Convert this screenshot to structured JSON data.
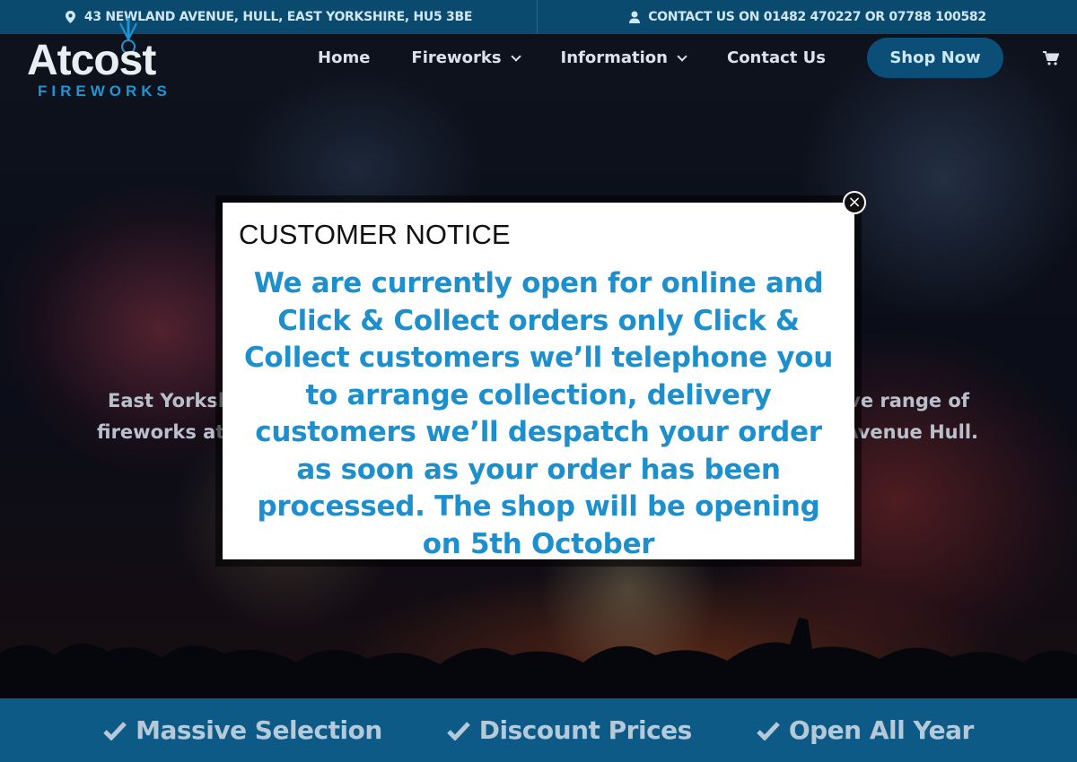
{
  "topbar": {
    "address": "43 NEWLAND AVENUE, HULL, EAST YORKSHIRE, HU5 3BE",
    "contact": "CONTACT US ON 01482 470227 OR 07788 100582",
    "address_icon": "map-pin-icon",
    "contact_icon": "user-icon"
  },
  "logo": {
    "word": "Atcost",
    "sub": "FIREWORKS"
  },
  "nav": {
    "items": [
      {
        "label": "Home"
      },
      {
        "label": "Fireworks"
      },
      {
        "label": "Information"
      },
      {
        "label": "Contact Us"
      }
    ],
    "shop_label": "Shop Now",
    "cart_icon": "shopping-cart-icon"
  },
  "hero": {
    "line1_left": "East Yorksl",
    "line1_right": "ve range of",
    "line2_left": "fireworks at",
    "line2_right": "Avenue Hull."
  },
  "modal": {
    "title": "CUSTOMER NOTICE",
    "body": "We are currently open for online and Click & Collect orders only Click & Collect customers we’ll telephone you to arrange collection, delivery customers we’ll despatch your order as soon as your order has been processed. The shop will be opening on 5th October",
    "close_symbol": "×"
  },
  "features": [
    {
      "label": "Massive Selection"
    },
    {
      "label": "Discount Prices"
    },
    {
      "label": "Open All Year"
    }
  ],
  "colors": {
    "topbar_bg": "#0b4a6f",
    "accent": "#1d8fcd",
    "shop_button": "#0b4f79",
    "bottombar_bg": "#0e5a86"
  }
}
